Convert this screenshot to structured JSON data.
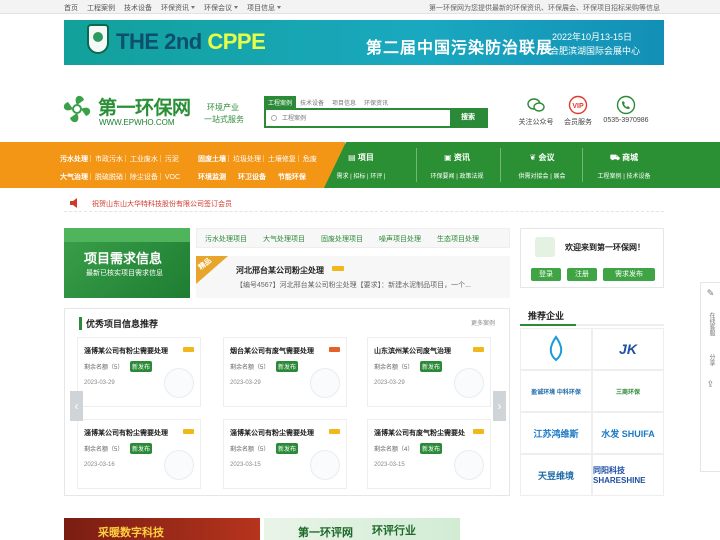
{
  "topbar": {
    "nav": [
      "首页",
      "工程案例",
      "技术设备",
      "环保资讯",
      "环保会议",
      "项目信息"
    ],
    "nav_dropdown": [
      false,
      false,
      false,
      true,
      true,
      true
    ],
    "slogan": "第一环保网为您提供最新的环保资讯、环保展会、环保项目招标采购等信息"
  },
  "banner": {
    "title_en_prefix": "THE 2nd ",
    "title_en_accent": "CPPE",
    "title_cn": "第二届中国污染防治联展",
    "date": "2022年10月13-15日",
    "venue": "合肥滨湖国际会展中心"
  },
  "logo": {
    "name": "第一环保网",
    "url": "WWW.EPWHO.COM",
    "tag1": "环境产业",
    "tag2": "一站式服务"
  },
  "search": {
    "tabs": [
      "工程案例",
      "技术设备",
      "项目信息",
      "环保资讯"
    ],
    "active_tab": 0,
    "placeholder": "工程案例",
    "button": "搜索"
  },
  "right_icons": [
    {
      "label": "关注公众号",
      "icon": "wechat-icon",
      "color": "#2b8a37"
    },
    {
      "label": "会员服务",
      "icon": "vip-icon",
      "color": "#e23b2e"
    },
    {
      "label": "0535-3970986",
      "icon": "phone-icon",
      "color": "#2b8a37"
    }
  ],
  "mainnav": {
    "row1_label": "污水处理",
    "row1_items": [
      "市政污水",
      "工业废水",
      "污泥"
    ],
    "row1b_label": "固废土壤",
    "row1b_items": [
      "垃圾处理",
      "土壤修复",
      "危废"
    ],
    "row2_label": "大气治理",
    "row2_items": [
      "脱硫脱硝",
      "除尘设备",
      "VOC"
    ],
    "row2b_items": [
      "环境监测",
      "环卫设备",
      "节能环保"
    ],
    "columns": [
      {
        "title": "项目",
        "sub": "需求 | 招标 | 环评 |",
        "icon": "doc-icon"
      },
      {
        "title": "资讯",
        "sub": "环保要闻 | 政策法规",
        "icon": "news-icon"
      },
      {
        "title": "会议",
        "sub": "供需对接会 | 展会",
        "icon": "leaf-icon"
      },
      {
        "title": "商城",
        "sub": "工程案例 | 技术设备",
        "icon": "cart-icon"
      }
    ]
  },
  "notice": "祝贺山东山大华特科技股份有限公司签订会员",
  "promo": {
    "title": "项目需求信息",
    "subtitle": "最新已核实项目需求信息"
  },
  "project_tabs": [
    "污水处理项目",
    "大气处理项目",
    "固废处理项目",
    "噪声项目处理",
    "生态项目处理"
  ],
  "featured": {
    "ribbon": "精品",
    "title": "河北邢台某公司粉尘处理",
    "desc": "【编号4567】河北邢台某公司粉尘处理【要求】：新建水泥制品项目，一个..."
  },
  "excellent": {
    "title": "优秀项目信息推荐",
    "more": "更多案例",
    "count_prefix": "剩余名额（",
    "count_suffix": "）",
    "new_label": "新发布",
    "items": [
      {
        "title": "淄博某公司有粉尘需要处理",
        "count": "5",
        "date": "2023-03-29",
        "hot": "yellow"
      },
      {
        "title": "烟台某公司有废气需要处理",
        "count": "5",
        "date": "2023-03-29",
        "hot": "red"
      },
      {
        "title": "山东滨州某公司废气治理",
        "count": "5",
        "date": "2023-03-29",
        "hot": "yellow"
      },
      {
        "title": "淄博某公司有粉尘需要处理",
        "count": "5",
        "date": "2023-03-16",
        "hot": "yellow"
      },
      {
        "title": "淄博某公司有粉尘需要处理",
        "count": "5",
        "date": "2023-03-15",
        "hot": "yellow"
      },
      {
        "title": "淄博某公司有废气粉尘需要处",
        "count": "4",
        "date": "2023-03-15",
        "hot": "yellow"
      }
    ]
  },
  "welcome": {
    "text": "欢迎来到第一环保网！",
    "login": "登录",
    "register": "注册",
    "publish": "需求发布"
  },
  "recommend": {
    "title": "推荐企业",
    "companies": [
      {
        "name": "",
        "color": "#1b9bd7"
      },
      {
        "name": "JK",
        "color": "#1e4fa3"
      },
      {
        "name": "盈诚环境 中科环保",
        "color": "#1e6aa8"
      },
      {
        "name": "三商环保",
        "color": "#2b8a37"
      },
      {
        "name": "江苏鸿维斯",
        "color": "#1b78c6"
      },
      {
        "name": "水发 SHUIFA",
        "color": "#1b78c6"
      },
      {
        "name": "天昱维境",
        "color": "#1e6aa8"
      },
      {
        "name": "同阳科技 SHARESHINE",
        "color": "#1e4fa3"
      }
    ]
  },
  "sidebar": {
    "items": [
      "在线客服",
      "分享"
    ]
  },
  "bottom": {
    "left": "采暖数字科技",
    "right_a": "第一环评网",
    "right_b": "环评行业"
  }
}
